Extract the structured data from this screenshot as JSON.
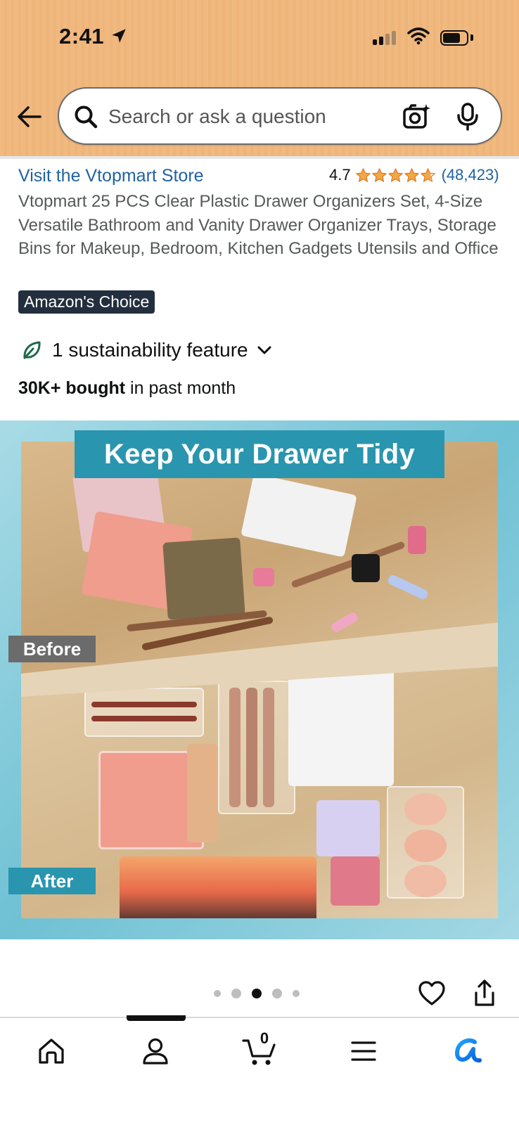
{
  "status_bar": {
    "time": "2:41",
    "icons": [
      "location-arrow-icon",
      "cellular-signal-icon",
      "wifi-icon",
      "battery-icon"
    ]
  },
  "header": {
    "background_color": "#f0b97f",
    "search": {
      "placeholder": "Search or ask a question",
      "value": ""
    },
    "icons": [
      "back-arrow-icon",
      "search-icon",
      "camera-icon",
      "microphone-icon"
    ]
  },
  "product": {
    "store_link": "Visit the Vtopmart Store",
    "rating": "4.7",
    "rating_stars": 4.7,
    "rating_count": "(48,423)",
    "title": "Vtopmart 25 PCS Clear Plastic Drawer Organizers Set, 4-Size Versatile Bathroom and Vanity Drawer Organizer Trays, Storage Bins for Makeup, Bedroom, Kitchen Gadgets Utensils and Office",
    "badge": "Amazon's Choice",
    "sustainability": "1 sustainability feature",
    "bought_bold": "30K+ bought",
    "bought_rest": " in past month"
  },
  "image": {
    "banner": "Keep Your Drawer Tidy",
    "before_label": "Before",
    "after_label": "After",
    "accent_color": "#2a95ae"
  },
  "carousel": {
    "total_dots": 5,
    "active_index": 2
  },
  "bottom_nav": {
    "items": [
      "home-icon",
      "account-icon",
      "cart-icon",
      "menu-icon",
      "rufus-icon"
    ],
    "cart_count": "0"
  },
  "colors": {
    "link": "#2162a1",
    "star": "#f3a847",
    "badge_bg": "#232f3e"
  }
}
